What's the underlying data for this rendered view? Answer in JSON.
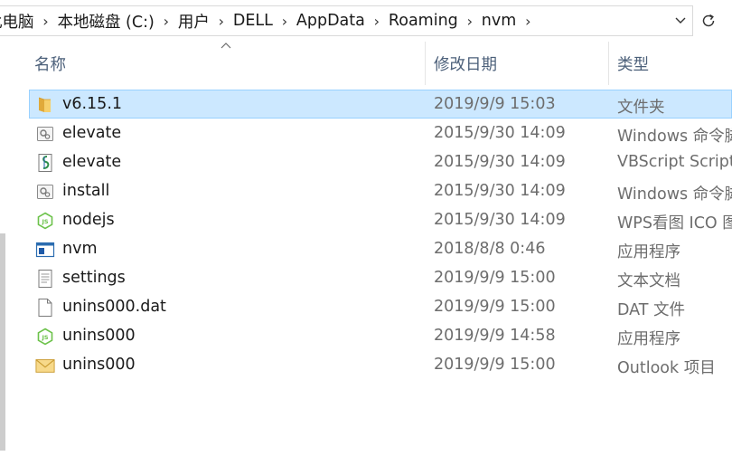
{
  "address": {
    "segments": [
      "此电脑",
      "本地磁盘 (C:)",
      "用户",
      "DELL",
      "AppData",
      "Roaming",
      "nvm"
    ],
    "separator": "›"
  },
  "columns": {
    "name": "名称",
    "date": "修改日期",
    "type": "类型",
    "sort_column": "name",
    "sort_direction": "ascending"
  },
  "files": [
    {
      "name": "v6.15.1",
      "date": "2019/9/9 15:03",
      "type": "文件夹",
      "icon": "folder-icon",
      "selected": true
    },
    {
      "name": "elevate",
      "date": "2015/9/30 14:09",
      "type": "Windows 命令脚本",
      "icon": "batch-script-icon",
      "selected": false
    },
    {
      "name": "elevate",
      "date": "2015/9/30 14:09",
      "type": "VBScript Script File",
      "icon": "vbscript-icon",
      "selected": false
    },
    {
      "name": "install",
      "date": "2015/9/30 14:09",
      "type": "Windows 命令脚本",
      "icon": "batch-script-icon",
      "selected": false
    },
    {
      "name": "nodejs",
      "date": "2015/9/30 14:09",
      "type": "WPS看图 ICO 图片",
      "icon": "nodejs-icon",
      "selected": false
    },
    {
      "name": "nvm",
      "date": "2018/8/8 0:46",
      "type": "应用程序",
      "icon": "application-icon",
      "selected": false
    },
    {
      "name": "settings",
      "date": "2019/9/9 15:00",
      "type": "文本文档",
      "icon": "text-document-icon",
      "selected": false
    },
    {
      "name": "unins000.dat",
      "date": "2019/9/9 15:00",
      "type": "DAT 文件",
      "icon": "blank-file-icon",
      "selected": false
    },
    {
      "name": "unins000",
      "date": "2019/9/9 14:58",
      "type": "应用程序",
      "icon": "nodejs-icon",
      "selected": false
    },
    {
      "name": "unins000",
      "date": "2019/9/9 15:00",
      "type": "Outlook 项目",
      "icon": "mail-envelope-icon",
      "selected": false
    }
  ],
  "colors": {
    "selection_bg": "#cce8ff",
    "selection_border": "#99d1ff",
    "header_text": "#4c607a",
    "folder": "#f2c55c",
    "nodejs_green": "#6cc24a"
  }
}
